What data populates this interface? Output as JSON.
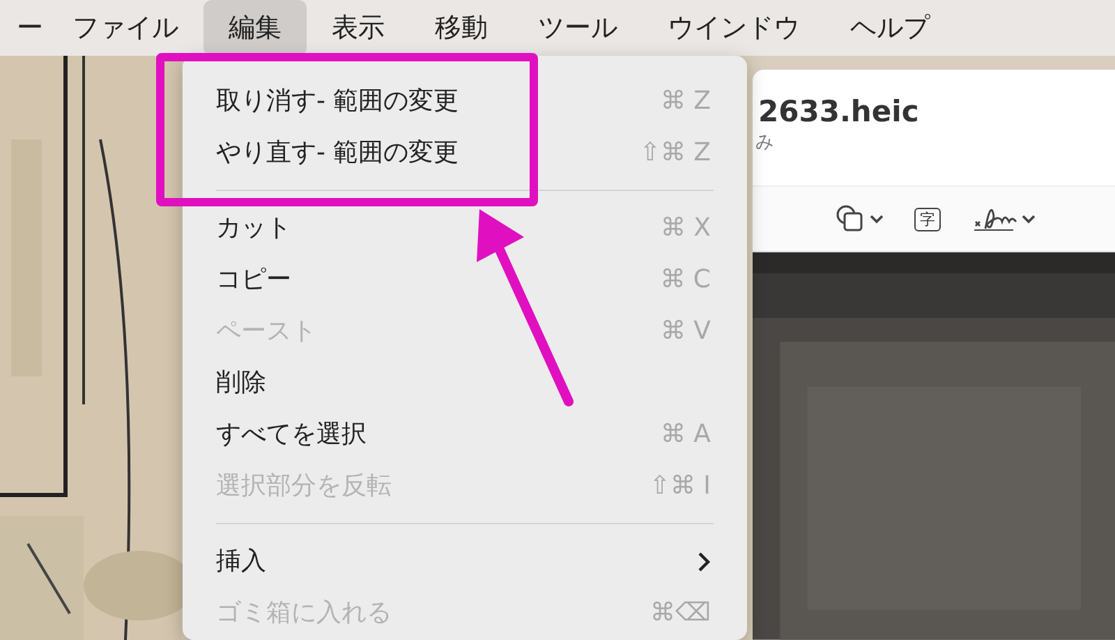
{
  "menu_bar": {
    "app_name": "ー",
    "items": [
      {
        "label": "ファイル",
        "selected": false
      },
      {
        "label": "編集",
        "selected": true
      },
      {
        "label": "表示",
        "selected": false
      },
      {
        "label": "移動",
        "selected": false
      },
      {
        "label": "ツール",
        "selected": false
      },
      {
        "label": "ウインドウ",
        "selected": false
      },
      {
        "label": "ヘルプ",
        "selected": false
      }
    ]
  },
  "edit_menu": {
    "items": [
      {
        "kind": "item",
        "label": "取り消す- 範囲の変更",
        "shortcut": "⌘ Z",
        "disabled": false
      },
      {
        "kind": "item",
        "label": "やり直す- 範囲の変更",
        "shortcut": "⇧⌘ Z",
        "disabled": false
      },
      {
        "kind": "separator"
      },
      {
        "kind": "item",
        "label": "カット",
        "shortcut": "⌘ X",
        "disabled": false
      },
      {
        "kind": "item",
        "label": "コピー",
        "shortcut": "⌘ C",
        "disabled": false
      },
      {
        "kind": "item",
        "label": "ペースト",
        "shortcut": "⌘ V",
        "disabled": true
      },
      {
        "kind": "item",
        "label": "削除",
        "disabled": false
      },
      {
        "kind": "item",
        "label": "すべてを選択",
        "shortcut": "⌘ A",
        "disabled": false
      },
      {
        "kind": "item",
        "label": "選択部分を反転",
        "shortcut": "⇧⌘ I",
        "disabled": true
      },
      {
        "kind": "separator"
      },
      {
        "kind": "submenu",
        "label": "挿入",
        "disabled": false
      },
      {
        "kind": "item",
        "label": "ゴミ箱に入れる",
        "shortcut": "⌘⌫",
        "disabled": true
      }
    ]
  },
  "window": {
    "title": "2633.heic",
    "subtitle": "み",
    "toolbar": {
      "text_button_label": "字"
    }
  }
}
